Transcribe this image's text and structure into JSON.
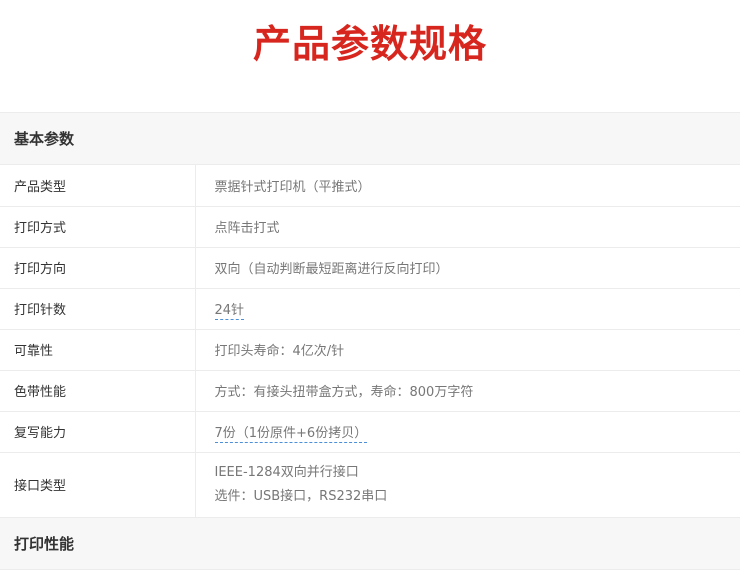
{
  "title": "产品参数规格",
  "sections": [
    {
      "heading": "基本参数",
      "rows": [
        {
          "label": "产品类型",
          "value": "票据针式打印机（平推式）"
        },
        {
          "label": "打印方式",
          "value": "点阵击打式"
        },
        {
          "label": "打印方向",
          "value": "双向（自动判断最短距离进行反向打印）"
        },
        {
          "label": "打印针数",
          "value": "24针"
        },
        {
          "label": "可靠性",
          "value": "打印头寿命：4亿次/针"
        },
        {
          "label": "色带性能",
          "value": "方式：有接头扭带盒方式，寿命：800万字符"
        },
        {
          "label": "复写能力",
          "value": "7份（1份原件+6份拷贝）"
        },
        {
          "label": "接口类型",
          "value_lines": [
            "IEEE-1284双向并行接口",
            "选件：USB接口，RS232串口"
          ]
        }
      ]
    },
    {
      "heading": "打印性能"
    }
  ]
}
